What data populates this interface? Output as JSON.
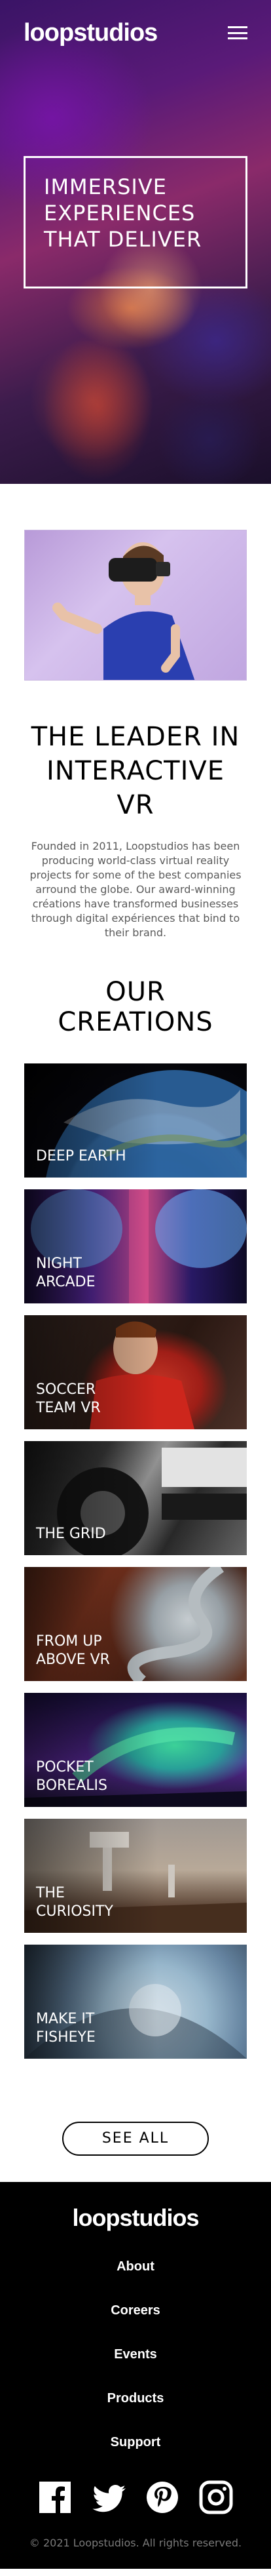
{
  "header": {
    "logo": "loopstudios",
    "menu_icon": "hamburger-menu-icon"
  },
  "hero": {
    "headline": "Immersive experiences that deliver"
  },
  "intro": {
    "title": "The leader in interactive VR",
    "body": "Founded in 2011, Loopstudios has been producing world-class virtual reality projects for some of the best companies arround the globe. Our award-winning créations have transformed businesses through digital expériences that bind to their brand."
  },
  "creations": {
    "title": "Our creations",
    "items": [
      {
        "label": "Deep earth"
      },
      {
        "label": "Night arcade"
      },
      {
        "label": "Soccer team VR"
      },
      {
        "label": "The grid"
      },
      {
        "label": "From up above VR"
      },
      {
        "label": "Pocket borealis"
      },
      {
        "label": "The curiosity"
      },
      {
        "label": "Make it fisheye"
      }
    ],
    "see_all": "See all"
  },
  "footer": {
    "logo": "loopstudios",
    "nav": [
      "About",
      "Coreers",
      "Events",
      "Products",
      "Support"
    ],
    "socials": [
      "facebook-icon",
      "twitter-icon",
      "pinterest-icon",
      "instagram-icon"
    ],
    "copyright": "© 2021 Loopstudios. All rights reserved."
  },
  "colors": {
    "hero_bg": "#3a1466",
    "footer_bg": "#000000",
    "text": "#000000",
    "muted_text": "#5a5a5a"
  }
}
